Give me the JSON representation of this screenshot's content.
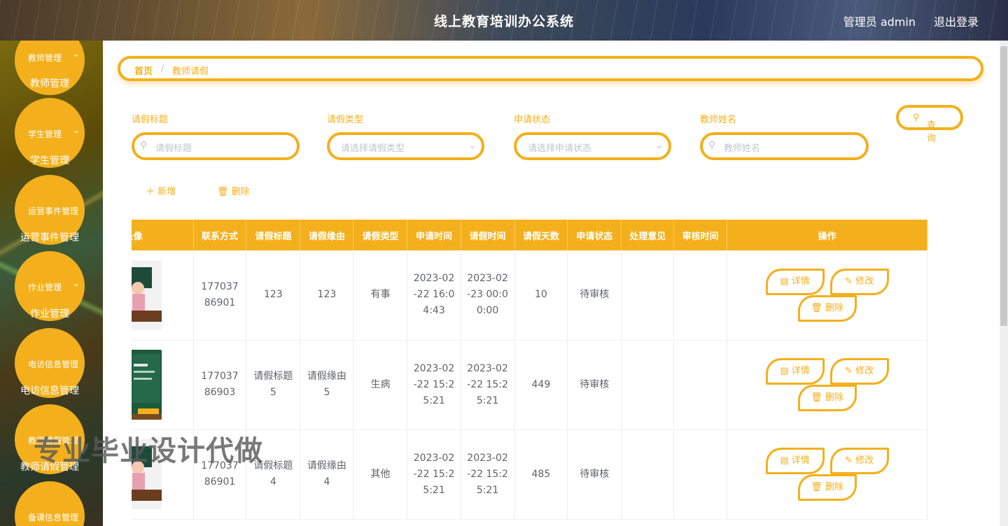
{
  "header": {
    "title": "线上教育培训办公系统",
    "user": "管理员 admin",
    "logout": "退出登录"
  },
  "sidebar": {
    "items": [
      {
        "head": "教师管理",
        "sub": "教师管理",
        "chevron": true
      },
      {
        "head": "学生管理",
        "sub": "学生管理",
        "chevron": true
      },
      {
        "head": "运营事件管理",
        "sub": "运营事件管理",
        "chevron": false
      },
      {
        "head": "作业管理",
        "sub": "作业管理",
        "chevron": true
      },
      {
        "head": "电访信息管理",
        "sub": "电访信息管理",
        "chevron": false
      },
      {
        "head": "教师请假管理",
        "sub": "教师请假管理",
        "chevron": false
      },
      {
        "head": "备课信息管理",
        "sub": "",
        "chevron": false
      }
    ]
  },
  "breadcrumb": {
    "home": "首页",
    "sep": "/",
    "current": "教师请假"
  },
  "filters": {
    "title_label": "请假标题",
    "title_placeholder": "请假标题",
    "type_label": "请假类型",
    "type_placeholder": "请选择请假类型",
    "status_label": "申请状态",
    "status_placeholder": "请选择申请状态",
    "name_label": "教师姓名",
    "name_placeholder": "教师姓名",
    "query": "查询"
  },
  "toolbar": {
    "add": "新增",
    "delete": "删除"
  },
  "table": {
    "headers": [
      "头像",
      "联系方式",
      "请假标题",
      "请假缘由",
      "请假类型",
      "申请时间",
      "请假时间",
      "请假天数",
      "申请状态",
      "处理意见",
      "审核时间",
      "操作"
    ],
    "rows": [
      {
        "phone": "17703786901",
        "title": "123",
        "reason": "123",
        "type": "有事",
        "apply_time": "2023-02-22 16:04:43",
        "leave_time": "2023-02-23 00:00:00",
        "days": "10",
        "status": "待审核",
        "opinion": "",
        "audit_time": ""
      },
      {
        "phone": "17703786903",
        "title": "请假标题5",
        "reason": "请假缘由5",
        "type": "生病",
        "apply_time": "2023-02-22 15:25:21",
        "leave_time": "2023-02-22 15:25:21",
        "days": "449",
        "status": "待审核",
        "opinion": "",
        "audit_time": ""
      },
      {
        "phone": "17703786901",
        "title": "请假标题4",
        "reason": "请假缘由4",
        "type": "其他",
        "apply_time": "2023-02-22 15:25:21",
        "leave_time": "2023-02-22 15:25:21",
        "days": "485",
        "status": "待审核",
        "opinion": "",
        "audit_time": ""
      }
    ],
    "actions": {
      "detail": "详情",
      "edit": "修改",
      "delete": "删除"
    }
  },
  "watermark": "专业毕业设计代做",
  "colors": {
    "accent": "#f3b01c",
    "text": "#606266",
    "placeholder": "#c0c4cc"
  }
}
